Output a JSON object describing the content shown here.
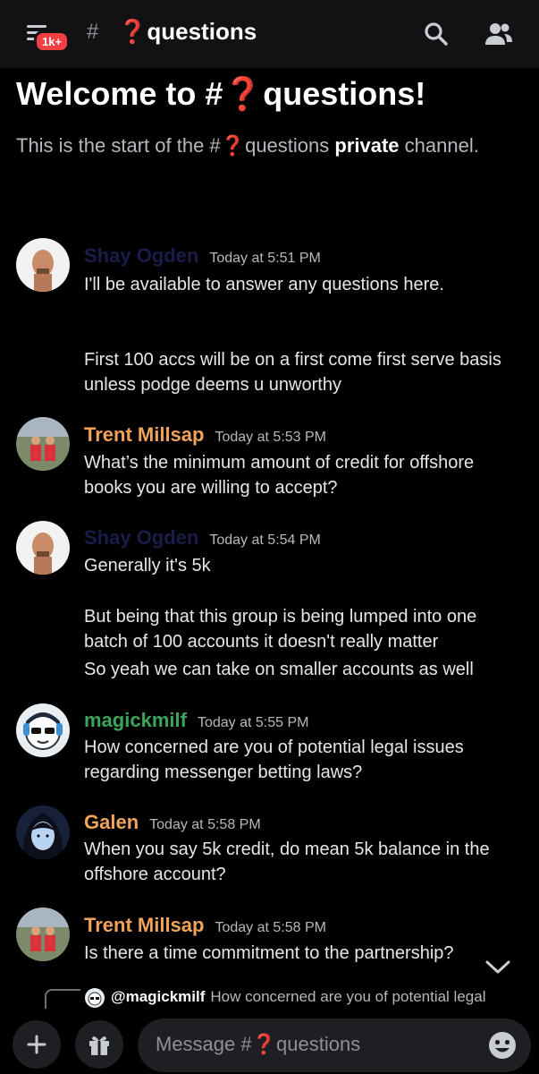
{
  "header": {
    "badge": "1k+",
    "hash": "#",
    "channel_emoji": "❓",
    "channel_name": "questions",
    "icons": [
      "menu-icon",
      "search-icon",
      "members-icon"
    ]
  },
  "welcome": {
    "title_prefix": "Welcome to #",
    "title_emoji": "❓",
    "title_suffix": "questions!",
    "sub_prefix": "This is the start of the #",
    "sub_emoji": "❓",
    "sub_middle": "questions ",
    "sub_bold": "private",
    "sub_suffix": " channel."
  },
  "messages": [
    {
      "author": "Shay Ogden",
      "author_color": "#1c1c4a",
      "timestamp": "Today at 5:51 PM",
      "lines": [
        "I'll be available to answer any questions here.",
        "First 100 accs will be on a first come first serve basis unless podge deems u unworthy"
      ]
    },
    {
      "author": "Trent Millsap",
      "author_color": "#f0a35a",
      "timestamp": "Today at 5:53 PM",
      "lines": [
        "What’s the minimum amount of credit for offshore books you are willing to accept?"
      ]
    },
    {
      "author": "Shay Ogden",
      "author_color": "#1c1c4a",
      "timestamp": "Today at 5:54 PM",
      "lines": [
        "Generally it's 5k",
        "But being that this group is being lumped into one batch of 100 accounts it doesn't really matter",
        "So yeah we can take on smaller accounts as well"
      ]
    },
    {
      "author": "magickmilf",
      "author_color": "#3ba55c",
      "timestamp": "Today at 5:55 PM",
      "lines": [
        "How concerned are you of potential legal issues regarding messenger betting laws?"
      ]
    },
    {
      "author": "Galen",
      "author_color": "#f0a35a",
      "timestamp": "Today at 5:58 PM",
      "lines": [
        "When you say 5k credit, do mean 5k balance in the offshore account?"
      ]
    },
    {
      "author": "Trent Millsap",
      "author_color": "#f0a35a",
      "timestamp": "Today at 5:58 PM",
      "lines": [
        "Is there a time commitment to the partnership?"
      ]
    }
  ],
  "reply": {
    "user": "@magickmilf",
    "text": "How concerned are you of potential legal"
  },
  "composer": {
    "placeholder_prefix": "Message #",
    "placeholder_emoji": "❓",
    "placeholder_suffix": "questions"
  }
}
